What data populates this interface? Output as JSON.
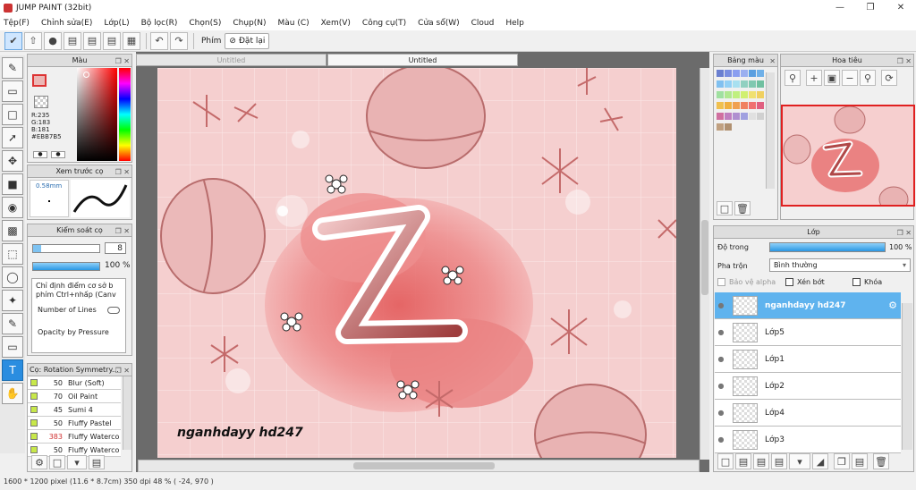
{
  "app": {
    "title": "JUMP PAINT (32bit)"
  },
  "menu": [
    "Tệp(F)",
    "Chỉnh sửa(E)",
    "Lớp(L)",
    "Bộ lọc(R)",
    "Chọn(S)",
    "Chụp(N)",
    "Màu (C)",
    "Xem(V)",
    "Công cụ(T)",
    "Cửa sổ(W)",
    "Cloud",
    "Help"
  ],
  "toolbar": {
    "label": "Phím",
    "reset": "Đặt lại"
  },
  "tabs": [
    "Untitled",
    "Untitled"
  ],
  "color_panel": {
    "title": "Màu",
    "r": "R:235",
    "g": "G:183",
    "b": "B:181",
    "hex": "#EBB7B5",
    "main_color": "#EBB7B5"
  },
  "preview_panel": {
    "title": "Xem trước cọ",
    "size": "0.58mm"
  },
  "brush_control": {
    "title": "Kiểm soát cọ",
    "size_value": "8",
    "opacity_value": "100 %",
    "opacity_fraction": 1.0,
    "hint": "Chỉ định điểm cơ sở b phím Ctrl+nhấp (Canv",
    "number_of_lines": "Number of Lines",
    "opacity_by_pressure": "Opacity by Pressure"
  },
  "brush_list": {
    "title": "Cọ: Rotation Symmetry...",
    "items": [
      {
        "num": "50",
        "name": "Blur (Soft)",
        "color": "#c8e84a"
      },
      {
        "num": "70",
        "name": "Oil Paint",
        "color": "#c8e84a"
      },
      {
        "num": "45",
        "name": "Sumi 4",
        "color": "#c8e84a"
      },
      {
        "num": "50",
        "name": "Fluffy Pastel",
        "color": "#c8e84a"
      },
      {
        "num": "383",
        "name": "Fluffy Waterco",
        "color": "#c8e84a",
        "num_color": "#d03030"
      },
      {
        "num": "50",
        "name": "Fluffy Waterco",
        "color": "#c8e84a"
      }
    ]
  },
  "palette_panel": {
    "title": "Bảng màu"
  },
  "navigator_panel": {
    "title": "Hoa tiêu"
  },
  "layer_panel": {
    "title": "Lớp",
    "opacity_label": "Độ trong",
    "opacity_value": "100 %",
    "blend_label": "Pha trộn",
    "blend_value": "Bình thường",
    "protect_alpha": "Bảo vệ alpha",
    "clipping": "Xén bớt",
    "lock": "Khóa",
    "layers": [
      {
        "name": "nganhdayy hd247",
        "selected": true
      },
      {
        "name": "Lớp5",
        "selected": false
      },
      {
        "name": "Lớp1",
        "selected": false
      },
      {
        "name": "Lớp2",
        "selected": false
      },
      {
        "name": "Lớp4",
        "selected": false
      },
      {
        "name": "Lớp3",
        "selected": false
      }
    ]
  },
  "artwork": {
    "watermark": "nganhdayy hd247",
    "letter": "Z"
  },
  "status": {
    "text": "1600 * 1200 pixel   (11.6 * 8.7cm)  350 dpi  48 %  ( -24, 970 )"
  }
}
